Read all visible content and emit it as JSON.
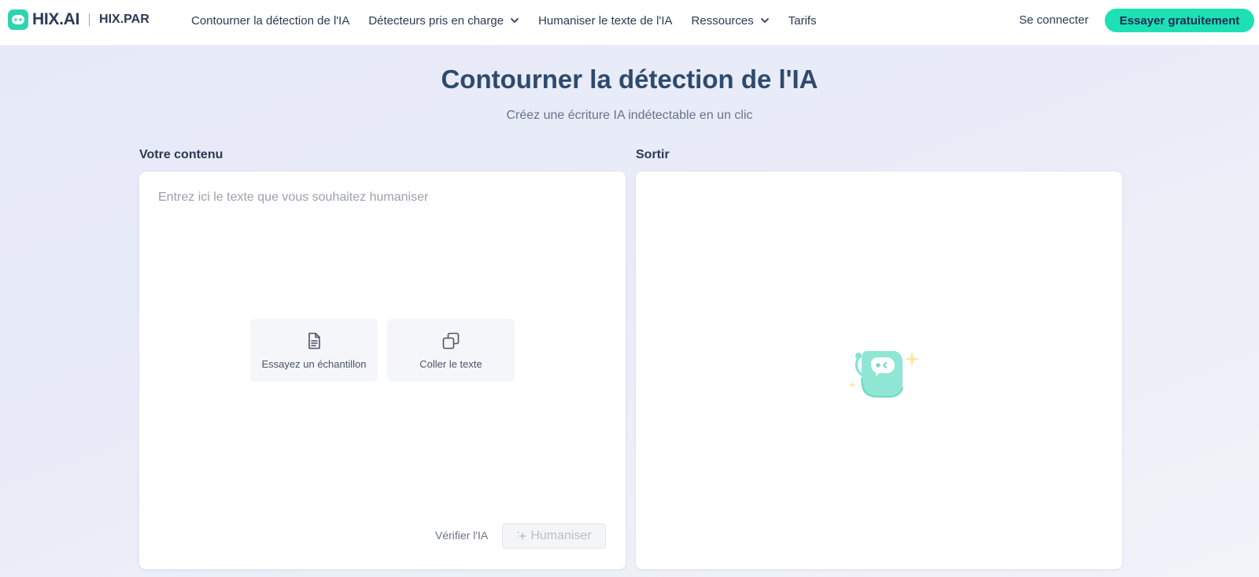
{
  "brand": {
    "name": "HIX.AI",
    "sub": "HIX.PAR",
    "accent": "#1de0b4",
    "text_color": "#2b3a55"
  },
  "nav": {
    "items": [
      {
        "label": "Contourner la détection de l'IA"
      },
      {
        "label": "Détecteurs pris en charge",
        "icon": "chevron-down-icon"
      },
      {
        "label": "Humaniser le texte de l'IA"
      },
      {
        "label": "Ressources",
        "icon": "chevron-down-icon"
      },
      {
        "label": "Tarifs"
      }
    ],
    "signin_label": "Se connecter",
    "cta_label": "Essayer gratuitement"
  },
  "hero": {
    "title": "Contourner la détection de l'IA",
    "subtitle": "Créez une écriture IA indétectable en un clic"
  },
  "input_panel": {
    "label": "Votre contenu",
    "placeholder": "Entrez ici le texte que vous souhaitez humaniser",
    "value": "",
    "actions": [
      {
        "label": "Essayez un échantillon",
        "icon": "document-icon"
      },
      {
        "label": "Coller le texte",
        "icon": "copy-icon"
      }
    ],
    "verify_label": "Vérifier l'IA",
    "humanize_label": "Humaniser",
    "humanize_icon": "sparkle-icon"
  },
  "output_panel": {
    "label": "Sortir",
    "illustration_icon": "chatbot-mascot-icon"
  }
}
